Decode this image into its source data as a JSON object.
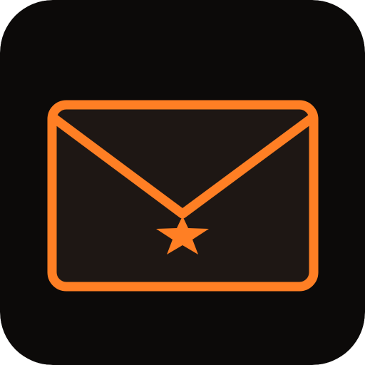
{
  "icon": {
    "name": "envelope-star",
    "colors": {
      "background": "#0c0a09",
      "envelope_fill": "#1e1714",
      "stroke": "#ff7f24",
      "star": "#ff7f24"
    }
  }
}
